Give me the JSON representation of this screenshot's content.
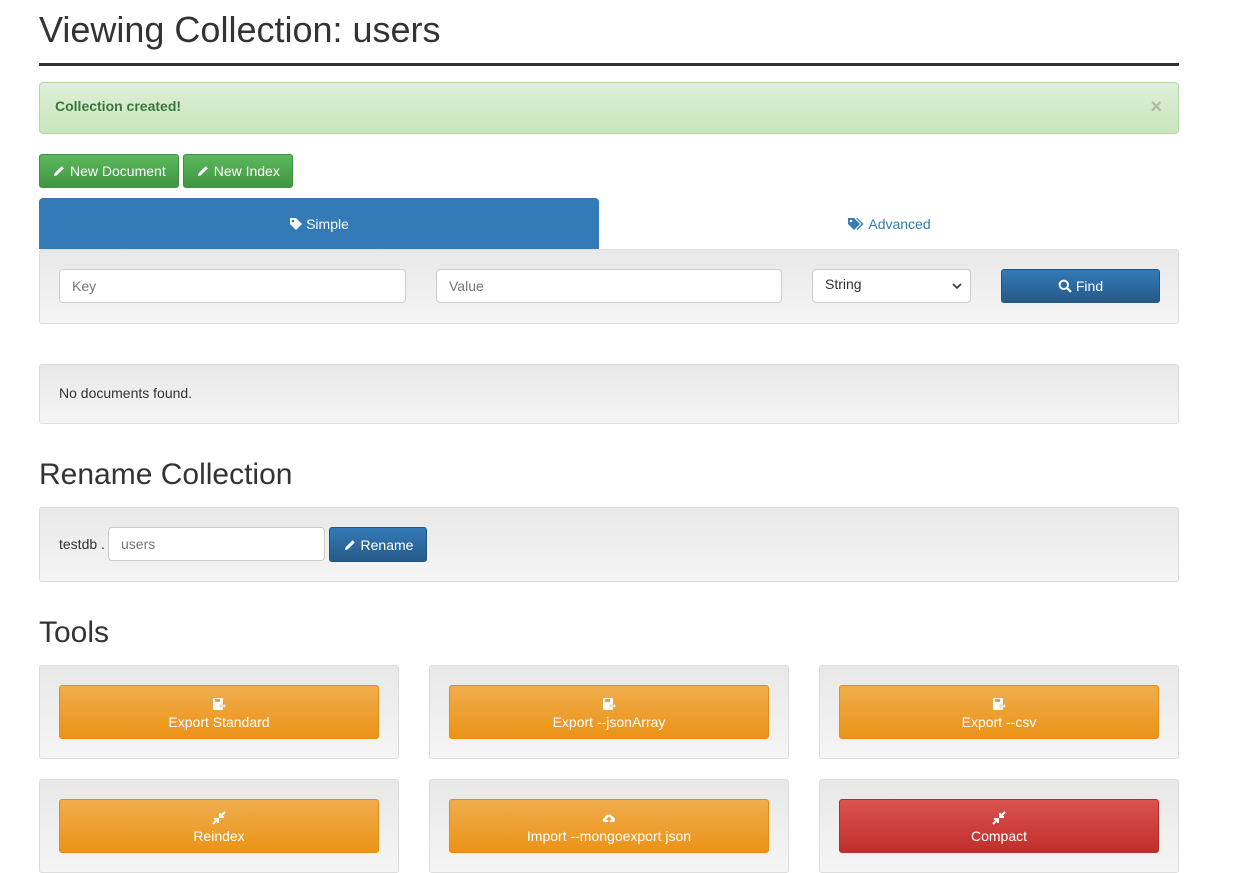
{
  "page": {
    "title": "Viewing Collection: users"
  },
  "alert": {
    "message": "Collection created!",
    "close_label": "×"
  },
  "actions": {
    "new_document": "New Document",
    "new_index": "New Index"
  },
  "tabs": {
    "simple": "Simple",
    "advanced": "Advanced"
  },
  "query": {
    "key_placeholder": "Key",
    "value_placeholder": "Value",
    "type_selected": "String",
    "find_label": "Find"
  },
  "results": {
    "empty_message": "No documents found."
  },
  "rename": {
    "title": "Rename Collection",
    "db_prefix": "testdb .",
    "input_placeholder": "users",
    "button_label": "Rename"
  },
  "tools": {
    "title": "Tools",
    "export_standard": "Export Standard",
    "export_jsonarray": "Export --jsonArray",
    "export_csv": "Export --csv",
    "reindex": "Reindex",
    "import_mongoexport": "Import --mongoexport json",
    "compact": "Compact"
  },
  "colors": {
    "primary": "#337ab7",
    "success": "#5cb85c",
    "warning": "#f0ad4e",
    "danger": "#d9534f",
    "alert_text": "#3c763d"
  }
}
